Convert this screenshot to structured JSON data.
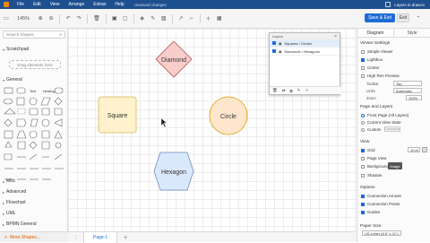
{
  "menubar": {
    "items": [
      "File",
      "Edit",
      "View",
      "Arrange",
      "Extras",
      "Help"
    ],
    "status": "Unsaved changes",
    "account": "Layers in draw.io"
  },
  "toolbar": {
    "zoom": "145%",
    "save_exit_label": "Save & Exit",
    "exit_label": "Exit"
  },
  "left": {
    "search_placeholder": "Search Shapes",
    "sections": [
      "Scratchpad",
      "General",
      "Misc",
      "Advanced",
      "Flowchart",
      "UML",
      "BPMN General"
    ],
    "drag_hint": "Drag elements here",
    "more_shapes": "More Shapes..."
  },
  "canvas": {
    "shapes": [
      {
        "type": "diamond",
        "label": "Diamond",
        "fill": "#f8cecc",
        "stroke": "#b85450"
      },
      {
        "type": "square",
        "label": "Square",
        "fill": "#fff2cc",
        "stroke": "#d6b656"
      },
      {
        "type": "circle",
        "label": "Circle",
        "fill": "#ffe6cc",
        "stroke": "#d79b00"
      },
      {
        "type": "hexagon",
        "label": "Hexagon",
        "fill": "#dae8fc",
        "stroke": "#6c8ebf"
      }
    ]
  },
  "pages": {
    "tab": "Page-1"
  },
  "layers": {
    "title": "Layers",
    "rows": [
      {
        "label": "Squares / Circles",
        "selected": true
      },
      {
        "label": "Diamonds / Hexagons",
        "selected": false
      }
    ]
  },
  "right": {
    "tabs": [
      "Diagram",
      "Style"
    ],
    "viewer_settings": "Viewer Settings",
    "viewer_options": [
      "Simple Viewer",
      "Lightbox",
      "Center",
      "High Res Preview"
    ],
    "toolbar_label": "Toolbar",
    "toolbar_value": "Top",
    "links_label": "Links",
    "links_value": "Automatic",
    "zoom_label": "Zoom",
    "zoom_value": "100%",
    "page_layers": "Page and Layers",
    "page_layer_options": [
      "Front Page (All Layers)",
      "Current View State",
      "Custom"
    ],
    "custom_btn": "Customize",
    "view": "View",
    "grid_label": "Grid",
    "grid_value": "10 pt",
    "page_view": "Page View",
    "background": "Background",
    "image_btn": "Image",
    "shadow": "Shadow",
    "options": "Options",
    "option_items": [
      "Connection Arrows",
      "Connection Points",
      "Guides"
    ],
    "paper_size": "Paper Size",
    "paper_value": "US-Letter (8.5\" x 11\")"
  },
  "colors": {
    "accent": "#1e6bd6",
    "menubar": "#1e4f8f"
  }
}
